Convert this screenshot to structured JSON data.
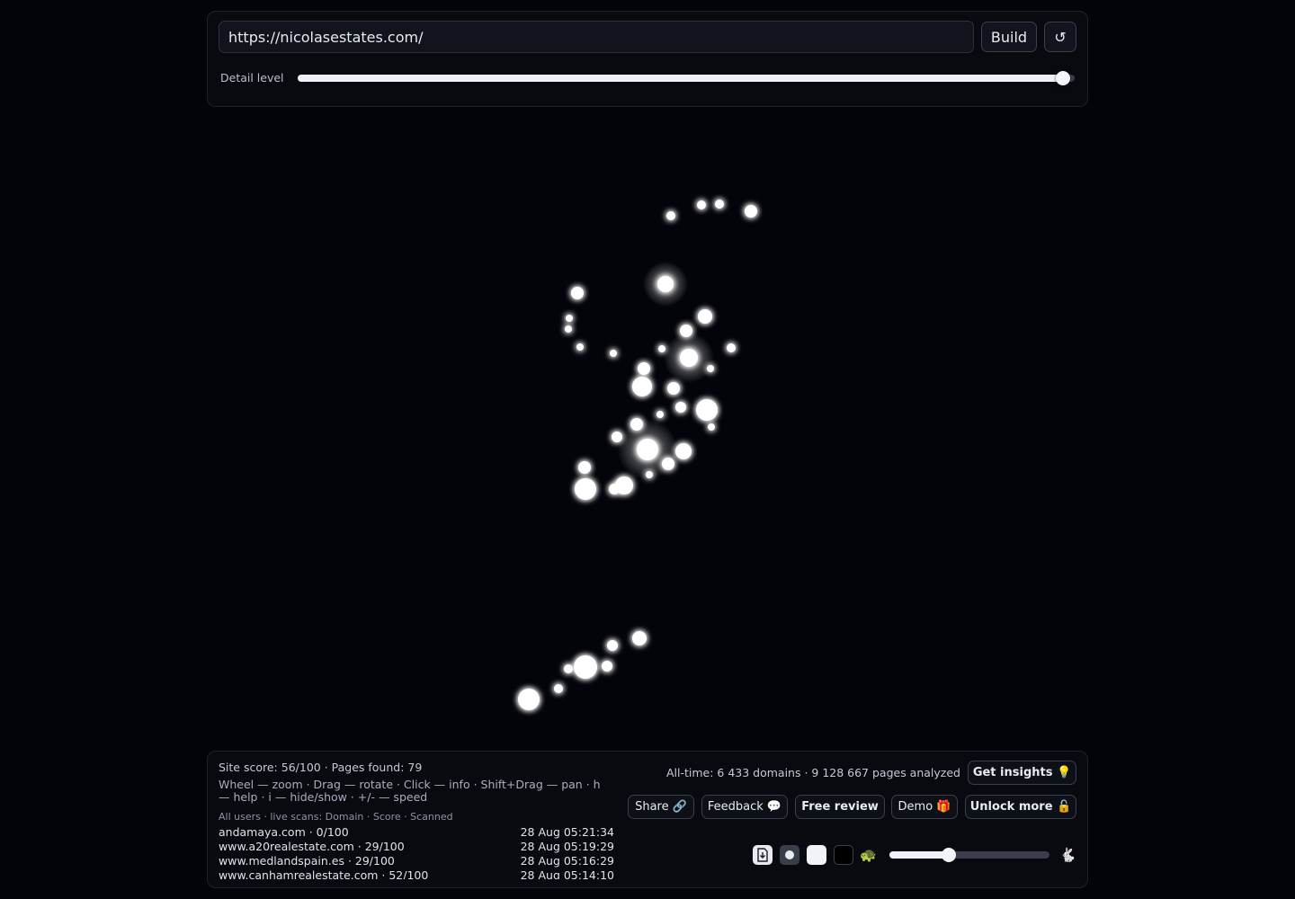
{
  "header": {
    "url_value": "https://nicolasestates.com/",
    "build_label": "Build",
    "reload_icon": "↺",
    "detail_label": "Detail level",
    "detail_level": 0.985
  },
  "graph": {
    "glow_color": "#ffffff"
  },
  "footer": {
    "site_score": "Site score: 56/100 · Pages found: 79",
    "help_text": "Wheel — zoom · Drag — rotate · Click — info · Shift+Drag — pan · h — help · i — hide/show · +/- — speed",
    "scans_header": "All users · live scans: Domain · Score · Scanned",
    "scans": [
      {
        "domain": "andamaya.com · 0/100",
        "time": "28 Aug 05:21:34"
      },
      {
        "domain": "www.a20realestate.com · 29/100",
        "time": "28 Aug 05:19:29"
      },
      {
        "domain": "www.medlandspain.es · 29/100",
        "time": "28 Aug 05:16:29"
      },
      {
        "domain": "www.canhamrealestate.com · 52/100",
        "time": "28 Aug 05:14:10"
      }
    ],
    "alltime": "All-time: 6 433 domains · 9 128 667 pages analyzed",
    "get_insights": "Get insights 💡",
    "share": "Share 🔗",
    "feedback": "Feedback 💬",
    "free_review": "Free review",
    "demo": "Demo 🎁",
    "unlock_more": "Unlock more 🔓",
    "turtle_icon": "🐢",
    "rabbit_icon": "🐇",
    "speed_level": 0.37
  }
}
